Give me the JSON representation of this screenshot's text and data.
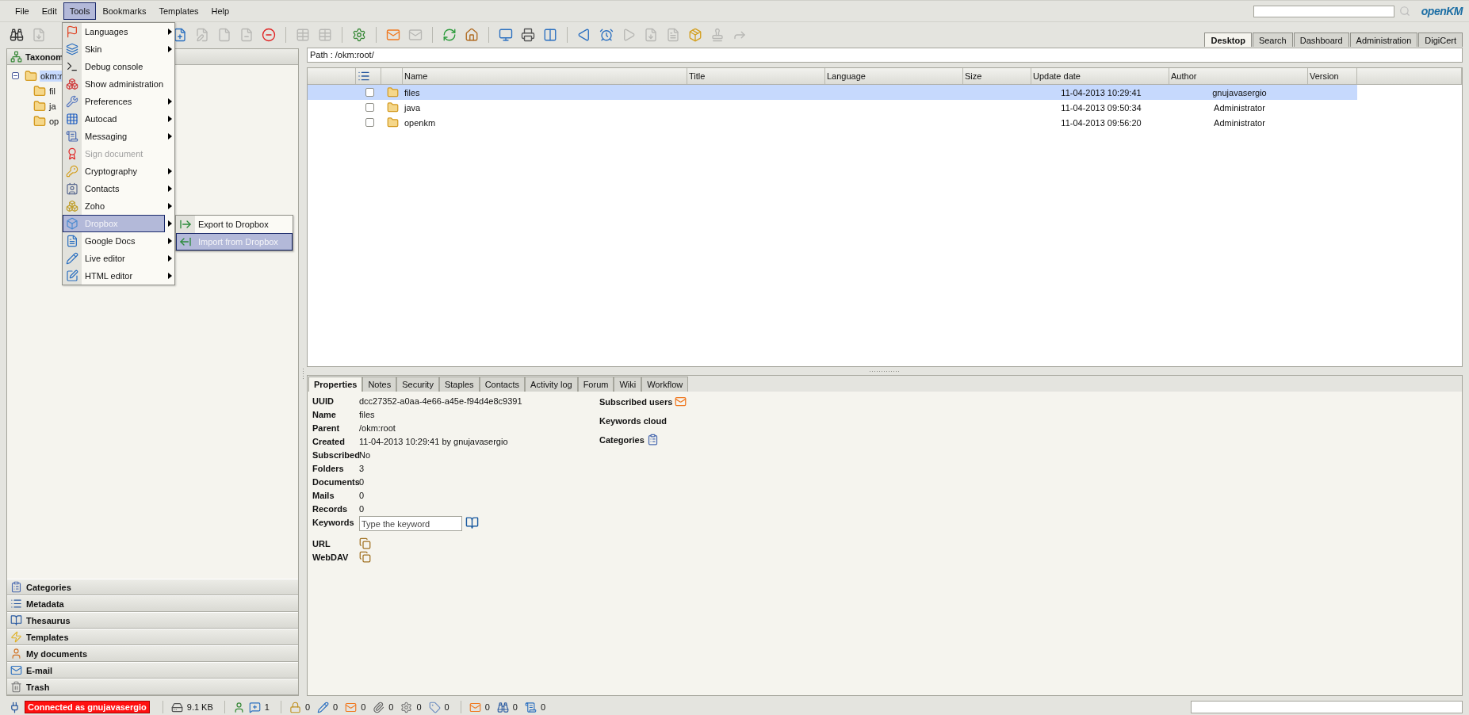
{
  "menubar": {
    "items": [
      {
        "label": "File",
        "selected": false
      },
      {
        "label": "Edit",
        "selected": false
      },
      {
        "label": "Tools",
        "selected": true
      },
      {
        "label": "Bookmarks",
        "selected": false
      },
      {
        "label": "Templates",
        "selected": false
      },
      {
        "label": "Help",
        "selected": false
      }
    ],
    "logo": "openKM"
  },
  "tools_menu": [
    {
      "label": "Languages",
      "submenu": true,
      "selected": false,
      "disabled": false
    },
    {
      "label": "Skin",
      "submenu": true,
      "selected": false,
      "disabled": false
    },
    {
      "label": "Debug console",
      "submenu": false,
      "selected": false,
      "disabled": false
    },
    {
      "label": "Show administration",
      "submenu": false,
      "selected": false,
      "disabled": false
    },
    {
      "label": "Preferences",
      "submenu": true,
      "selected": false,
      "disabled": false
    },
    {
      "label": "Autocad",
      "submenu": true,
      "selected": false,
      "disabled": false
    },
    {
      "label": "Messaging",
      "submenu": true,
      "selected": false,
      "disabled": false
    },
    {
      "label": "Sign document",
      "submenu": false,
      "selected": false,
      "disabled": true
    },
    {
      "label": "Cryptography",
      "submenu": true,
      "selected": false,
      "disabled": false
    },
    {
      "label": "Contacts",
      "submenu": true,
      "selected": false,
      "disabled": false
    },
    {
      "label": "Zoho",
      "submenu": true,
      "selected": false,
      "disabled": false
    },
    {
      "label": "Dropbox",
      "submenu": true,
      "selected": true,
      "disabled": false
    },
    {
      "label": "Google Docs",
      "submenu": true,
      "selected": false,
      "disabled": false
    },
    {
      "label": "Live editor",
      "submenu": true,
      "selected": false,
      "disabled": false
    },
    {
      "label": "HTML editor",
      "submenu": true,
      "selected": false,
      "disabled": false
    }
  ],
  "dropbox_submenu": [
    {
      "label": "Export to Dropbox",
      "selected": false
    },
    {
      "label": "Import from Dropbox",
      "selected": true
    }
  ],
  "toolbar": [
    {
      "kind": "button",
      "disabled": false
    },
    {
      "kind": "button",
      "disabled": true
    },
    {
      "kind": "button",
      "disabled": false
    },
    {
      "kind": "button",
      "disabled": true
    },
    {
      "kind": "button",
      "disabled": true
    },
    {
      "kind": "button",
      "disabled": true
    },
    {
      "kind": "button",
      "disabled": false
    },
    {
      "kind": "separator"
    },
    {
      "kind": "button",
      "disabled": true
    },
    {
      "kind": "button",
      "disabled": true
    },
    {
      "kind": "separator"
    },
    {
      "kind": "button",
      "disabled": false
    },
    {
      "kind": "separator"
    },
    {
      "kind": "button",
      "disabled": false
    },
    {
      "kind": "button",
      "disabled": true
    },
    {
      "kind": "separator"
    },
    {
      "kind": "button",
      "disabled": false
    },
    {
      "kind": "button",
      "disabled": false
    },
    {
      "kind": "separator"
    },
    {
      "kind": "button",
      "disabled": false
    },
    {
      "kind": "button",
      "disabled": false
    },
    {
      "kind": "button",
      "disabled": false
    },
    {
      "kind": "separator"
    },
    {
      "kind": "button",
      "disabled": false
    },
    {
      "kind": "button",
      "disabled": false
    },
    {
      "kind": "button",
      "disabled": true
    },
    {
      "kind": "button",
      "disabled": true
    },
    {
      "kind": "button",
      "disabled": true
    },
    {
      "kind": "button",
      "disabled": false
    },
    {
      "kind": "button",
      "disabled": true
    },
    {
      "kind": "button",
      "disabled": true
    }
  ],
  "view_tabs": [
    {
      "label": "Desktop",
      "selected": true
    },
    {
      "label": "Search",
      "selected": false
    },
    {
      "label": "Dashboard",
      "selected": false
    },
    {
      "label": "Administration",
      "selected": false
    },
    {
      "label": "DigiCert",
      "selected": false
    }
  ],
  "taxonomy": {
    "title": "Taxonom",
    "tree": [
      {
        "label": "okm:r",
        "expanded": true,
        "selected": true,
        "children": [
          {
            "label": "fil",
            "selected": false
          },
          {
            "label": "ja",
            "selected": false
          },
          {
            "label": "op",
            "selected": false
          }
        ]
      }
    ]
  },
  "accordion": [
    "Categories",
    "Metadata",
    "Thesaurus",
    "Templates",
    "My documents",
    "E-mail",
    "Trash"
  ],
  "path": "Path : /okm:root/",
  "table": {
    "columns": [
      "Name",
      "Title",
      "Language",
      "Size",
      "Update date",
      "Author",
      "Version"
    ],
    "rows": [
      {
        "name": "files",
        "update_date": "11-04-2013 10:29:41",
        "author": "gnujavasergio",
        "selected": true,
        "checked": false
      },
      {
        "name": "java",
        "update_date": "11-04-2013 09:50:34",
        "author": "Administrator",
        "selected": false,
        "checked": false
      },
      {
        "name": "openkm",
        "update_date": "11-04-2013 09:56:20",
        "author": "Administrator",
        "selected": false,
        "checked": false
      }
    ]
  },
  "detail_tabs": [
    {
      "label": "Properties",
      "selected": true
    },
    {
      "label": "Notes",
      "selected": false
    },
    {
      "label": "Security",
      "selected": false
    },
    {
      "label": "Staples",
      "selected": false
    },
    {
      "label": "Contacts",
      "selected": false
    },
    {
      "label": "Activity log",
      "selected": false
    },
    {
      "label": "Forum",
      "selected": false
    },
    {
      "label": "Wiki",
      "selected": false
    },
    {
      "label": "Workflow",
      "selected": false
    }
  ],
  "properties": {
    "fields": [
      {
        "kind": "text",
        "label": "UUID",
        "value": "dcc27352-a0aa-4e66-a45e-f94d4e8c9391"
      },
      {
        "kind": "text",
        "label": "Name",
        "value": "files"
      },
      {
        "kind": "text",
        "label": "Parent",
        "value": "/okm:root"
      },
      {
        "kind": "text",
        "label": "Created",
        "value": "11-04-2013 10:29:41 by gnujavasergio"
      },
      {
        "kind": "text",
        "label": "Subscribed",
        "value": "No"
      },
      {
        "kind": "text",
        "label": "Folders",
        "value": "3"
      },
      {
        "kind": "text",
        "label": "Documents",
        "value": "0"
      },
      {
        "kind": "text",
        "label": "Mails",
        "value": "0"
      },
      {
        "kind": "text",
        "label": "Records",
        "value": "0"
      },
      {
        "kind": "input",
        "label": "Keywords",
        "placeholder": "Type the keyword"
      },
      {
        "kind": "copy",
        "label": "URL"
      },
      {
        "kind": "copy",
        "label": "WebDAV"
      }
    ],
    "side": [
      {
        "label": "Subscribed users"
      },
      {
        "label": "Keywords cloud"
      },
      {
        "label": "Categories"
      }
    ]
  },
  "status_bar": {
    "connection": "Connected as gnujavasergio",
    "size": "9.1 KB",
    "counters": [
      "1",
      "0",
      "0",
      "0",
      "0",
      "0",
      "0",
      "0",
      "0",
      "0"
    ]
  }
}
